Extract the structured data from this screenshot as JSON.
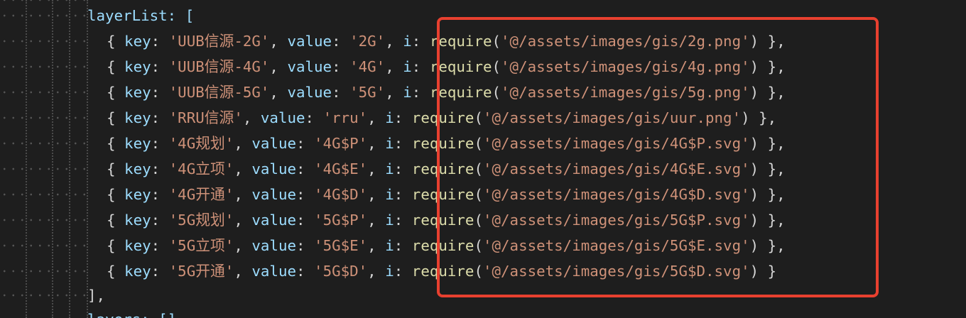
{
  "editor": {
    "top_line": "layerList: [",
    "close_line": "],",
    "bottom_line": "layers: []",
    "items": [
      {
        "key": "'UUB信源-2G'",
        "value": "'2G'",
        "path": "'@/assets/images/gis/2g.png'",
        "tail": " },"
      },
      {
        "key": "'UUB信源-4G'",
        "value": "'4G'",
        "path": "'@/assets/images/gis/4g.png'",
        "tail": " },"
      },
      {
        "key": "'UUB信源-5G'",
        "value": "'5G'",
        "path": "'@/assets/images/gis/5g.png'",
        "tail": " },"
      },
      {
        "key": "'RRU信源'",
        "value": "'rru'",
        "path": "'@/assets/images/gis/uur.png'",
        "tail": " },"
      },
      {
        "key": "'4G规划'",
        "value": "'4G$P'",
        "path": "'@/assets/images/gis/4G$P.svg'",
        "tail": " },"
      },
      {
        "key": "'4G立项'",
        "value": "'4G$E'",
        "path": "'@/assets/images/gis/4G$E.svg'",
        "tail": " },"
      },
      {
        "key": "'4G开通'",
        "value": "'4G$D'",
        "path": "'@/assets/images/gis/4G$D.svg'",
        "tail": " },"
      },
      {
        "key": "'5G规划'",
        "value": "'5G$P'",
        "path": "'@/assets/images/gis/5G$P.svg'",
        "tail": " },"
      },
      {
        "key": "'5G立项'",
        "value": "'5G$E'",
        "path": "'@/assets/images/gis/5G$E.svg'",
        "tail": " },"
      },
      {
        "key": "'5G开通'",
        "value": "'5G$D'",
        "path": "'@/assets/images/gis/5G$D.svg'",
        "tail": " }"
      }
    ],
    "tokens": {
      "open_brace": "{ ",
      "key_label": "key",
      "colon": ": ",
      "comma": ", ",
      "value_label": "value",
      "i_label": "i",
      "require": "require",
      "paren_open": "(",
      "paren_close": ")"
    },
    "colors": {
      "background": "#1e1e1e",
      "property": "#9cdcfe",
      "string": "#ce9178",
      "function": "#dcdcaa",
      "punctuation": "#d4d4d4",
      "highlight_border": "#e8402f"
    }
  }
}
